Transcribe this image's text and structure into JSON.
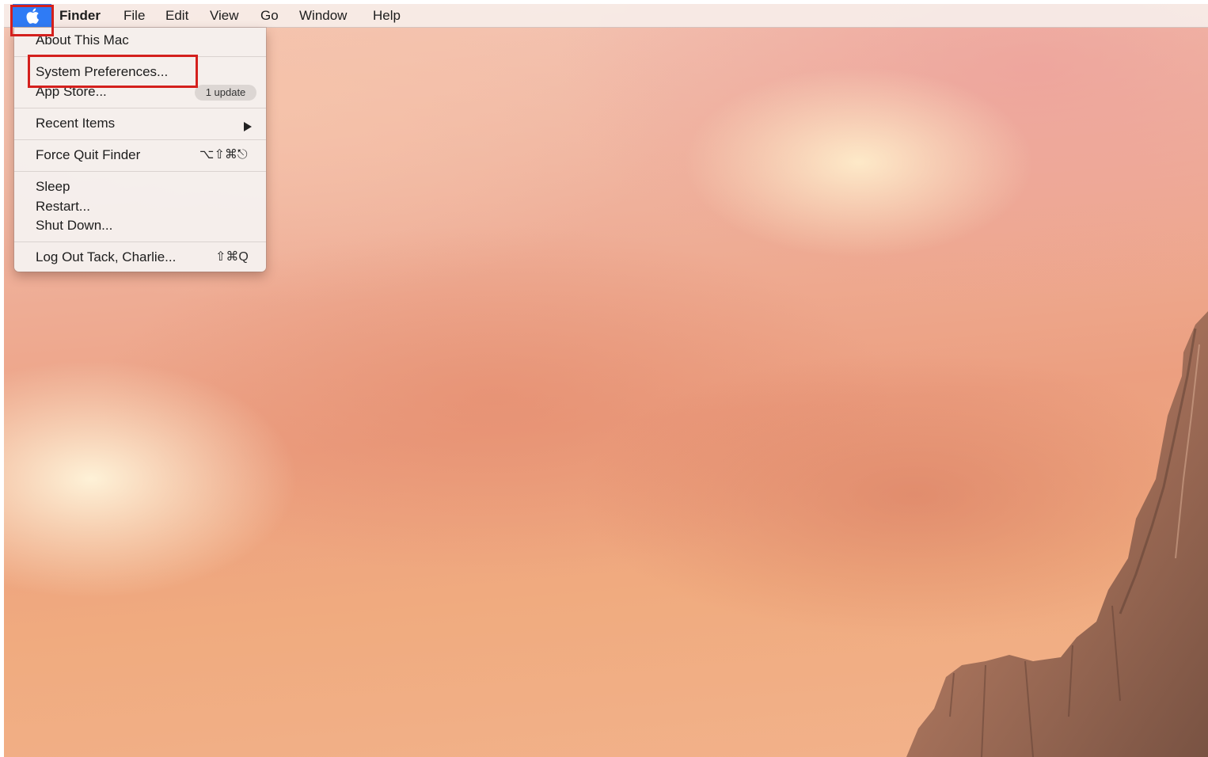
{
  "menubar": {
    "apple_icon": "apple-logo-icon",
    "items": [
      {
        "label": "Finder"
      },
      {
        "label": "File"
      },
      {
        "label": "Edit"
      },
      {
        "label": "View"
      },
      {
        "label": "Go"
      },
      {
        "label": "Window"
      },
      {
        "label": "Help"
      }
    ],
    "highlight_color": "#2f7bf5"
  },
  "apple_menu": {
    "about": "About This Mac",
    "system_preferences": "System Preferences...",
    "app_store": "App Store...",
    "app_store_badge": "1 update",
    "recent_items": "Recent Items",
    "recent_items_icon": "chevron-right-icon",
    "force_quit": "Force Quit Finder",
    "force_quit_shortcut": "⌥⇧⌘⎋",
    "sleep": "Sleep",
    "restart": "Restart...",
    "shut_down": "Shut Down...",
    "log_out": "Log Out Tack, Charlie...",
    "log_out_shortcut": "⇧⌘Q"
  },
  "annotations": {
    "color": "#d4201d"
  }
}
